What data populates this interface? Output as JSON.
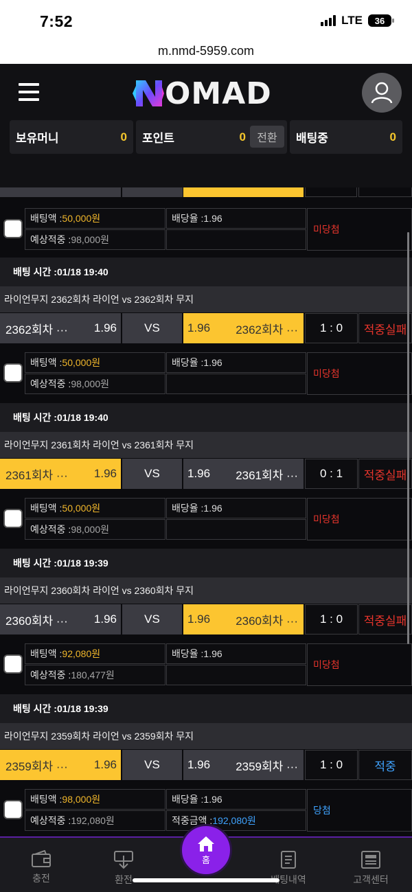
{
  "status_bar": {
    "time": "7:52",
    "network": "LTE",
    "battery": "36"
  },
  "browser": {
    "url": "m.nmd-5959.com"
  },
  "header": {
    "logo_text": "OMAD",
    "balances": [
      {
        "label": "보유머니",
        "value": "0"
      },
      {
        "label": "포인트",
        "value": "0",
        "action": "전환"
      },
      {
        "label": "배팅중",
        "value": "0"
      }
    ]
  },
  "labels": {
    "bet_amount": "배팅액 : ",
    "odds": "배당율 : ",
    "expected": "예상적중 : ",
    "win_amount": "적중금액 : ",
    "bet_time": "배팅 시간 : ",
    "vs": "VS"
  },
  "bets": [
    {
      "bet_amount": "50,000원",
      "odds": "1.96",
      "expected": "98,000원",
      "win_amount": "",
      "result": "미당첨"
    },
    {
      "time": "01/18 19:40",
      "match": "라이언무지 2362회차 라이언  vs  2362회차 무지",
      "home": "2362회차 ···",
      "home_odds": "1.96",
      "away": "2362회차 ···",
      "away_odds": "1.96",
      "selected": "away",
      "score": "1 : 0",
      "status": "적중실패",
      "bet_amount": "50,000원",
      "odds": "1.96",
      "expected": "98,000원",
      "win_amount": "",
      "result": "미당첨"
    },
    {
      "time": "01/18 19:40",
      "match": "라이언무지 2361회차 라이언  vs  2361회차 무지",
      "home": "2361회차 ···",
      "home_odds": "1.96",
      "away": "2361회차 ···",
      "away_odds": "1.96",
      "selected": "home",
      "score": "0 : 1",
      "status": "적중실패",
      "bet_amount": "50,000원",
      "odds": "1.96",
      "expected": "98,000원",
      "win_amount": "",
      "result": "미당첨"
    },
    {
      "time": "01/18 19:39",
      "match": "라이언무지 2360회차 라이언  vs  2360회차 무지",
      "home": "2360회차 ···",
      "home_odds": "1.96",
      "away": "2360회차 ···",
      "away_odds": "1.96",
      "selected": "away",
      "score": "1 : 0",
      "status": "적중실패",
      "bet_amount": "92,080원",
      "odds": "1.96",
      "expected": "180,477원",
      "win_amount": "",
      "result": "미당첨"
    },
    {
      "time": "01/18 19:39",
      "match": "라이언무지 2359회차 라이언  vs  2359회차 무지",
      "home": "2359회차 ···",
      "home_odds": "1.96",
      "away": "2359회차 ···",
      "away_odds": "1.96",
      "selected": "home",
      "score": "1 : 0",
      "status": "적중",
      "bet_amount": "98,000원",
      "odds": "1.96",
      "expected": "192,080원",
      "win_amount": "192,080원",
      "result": "당첨"
    }
  ],
  "nav": [
    {
      "label": "충전",
      "icon": "wallet-icon"
    },
    {
      "label": "환전",
      "icon": "withdraw-icon"
    },
    {
      "label": "홈",
      "icon": "home-icon"
    },
    {
      "label": "배팅내역",
      "icon": "document-icon"
    },
    {
      "label": "고객센터",
      "icon": "newspaper-icon"
    }
  ],
  "colors": {
    "accent": "#8a21e9",
    "gold": "#fcc530",
    "fail": "#e8352c",
    "win": "#3fa3ff"
  }
}
